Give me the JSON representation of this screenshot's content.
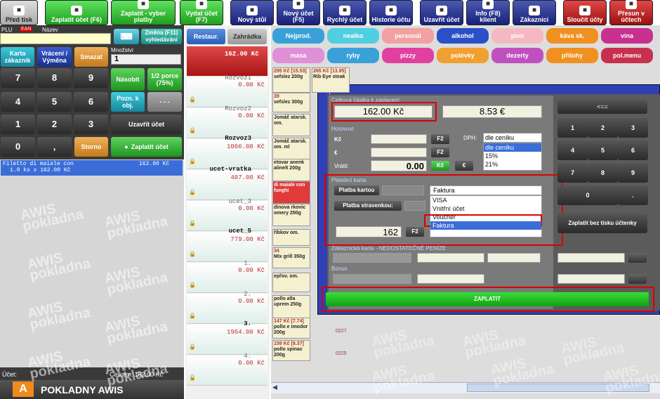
{
  "toolbar": {
    "buttons": [
      "Před tisk",
      "Zaplatit účet (F6)",
      "Zaplatit - vyber platby",
      "Vydat účet (F7)",
      "Nový stůl",
      "Nový účet (F5)",
      "Rychlý účet",
      "Historie účtu",
      "Uzavřít účet",
      "Info (F8) klient",
      "Zákazníci",
      "Sloučit účty",
      "Přesun v účtech"
    ]
  },
  "left": {
    "plu": "PLU",
    "ean": "EAN",
    "nazev": "Název",
    "zmena": "Změna (F11) vyhledávání",
    "karta": "Karta zákazník",
    "vraceni": "Vrácení / Výměna",
    "smazat": "Smazat",
    "mnozstvi_lbl": "Množství",
    "mnozstvi": "1",
    "nasobit": "Násobit",
    "pul": "1/2 porce (75%)",
    "pozn": "Pozn. k obj.",
    "dash": "- - -",
    "uzavrit": "Uzavřít účet",
    "storno": "Storno",
    "zaplatit": "Zaplatit účet",
    "keys": [
      "7",
      "8",
      "9",
      "4",
      "5",
      "6",
      "1",
      "2",
      "3",
      "0",
      ","
    ],
    "line1": "Filetto di maiale con",
    "line1_price": "162.00 Kč",
    "line2": "1.0 ks x 162.00 Kč",
    "ucet": "Účet:",
    "celkem": "Celkem: 162.00 Kč",
    "brand": "POKLADNY AWIS",
    "wm1": "AWIS",
    "wm2": "pokladna"
  },
  "mid": {
    "tab1": "Restaur.",
    "tab2": "Zahrádka",
    "top_price": "162.00 Kč",
    "rows": [
      {
        "name": "Rozvoz1",
        "price": "0.00 Kč"
      },
      {
        "name": "Rozvoz2",
        "price": "0.00 Kč"
      },
      {
        "name": "Rozvoz3",
        "price": "1066.00 Kč"
      },
      {
        "name": "ucet-vratka",
        "price": "407.00 Kč"
      },
      {
        "name": "ucet_3",
        "price": "0.00 Kč"
      },
      {
        "name": "ucet_5",
        "price": "779.00 Kč"
      },
      {
        "name": "1.",
        "price": "0.00 Kč"
      },
      {
        "name": "2.",
        "price": "0.00 Kč"
      },
      {
        "name": "3.",
        "price": "1964.00 Kč"
      },
      {
        "name": "4.",
        "price": "0.00 Kč"
      }
    ]
  },
  "categories": {
    "row1": [
      "Nejprod.",
      "nealko",
      "personál",
      "alkohol",
      "pivo",
      "káva sk.",
      "vína"
    ],
    "row2": [
      "masa",
      "ryby",
      "pizzy",
      "polévky",
      "dezerty",
      "přílohy",
      "pol.menu"
    ]
  },
  "tiles": [
    {
      "name": "sefslez 200g",
      "price": "295 Kč [15.53]"
    },
    {
      "name": "Rib Eye steak",
      "price": "265 Kč [13.95]"
    },
    {
      "name": "sefslez 300g",
      "price": "39"
    },
    {
      "name": "Jomáč atarsk. om.",
      "price": ""
    },
    {
      "name": "Jomáč atarsk. om. ml",
      "price": ""
    },
    {
      "name": "etovar anenk alinelt 200g",
      "price": ""
    },
    {
      "name": "di maiale con funghi",
      "price": ""
    },
    {
      "name": "dinova rkovic omery 250g",
      "price": ""
    },
    {
      "name": "říbkov om.",
      "price": ""
    },
    {
      "name": "Mix grill 350g",
      "price": "34"
    },
    {
      "name": "epřov. om.",
      "price": ""
    },
    {
      "name": "pollo alla uprem 250g",
      "price": ""
    },
    {
      "name": "pollo e imodor 200g",
      "price": "147 Kč [7.74]"
    },
    {
      "name": "pollo spinac 200g",
      "price": "159 Kč [8.37]"
    }
  ],
  "tile_codes": [
    "0227",
    "0225"
  ],
  "dialog": {
    "title": "Zaplatit",
    "celkova": "Celková částka k zaplacení",
    "kc": "162.00 Kč",
    "eur": "8.53 €",
    "hotovost": "Hotovost",
    "kc_lbl": "Kč",
    "eur_lbl": "€",
    "f2": "F2",
    "vratit": "Vrátit:",
    "vratit_val": "0.00",
    "kc_btn": "Kč",
    "eur_btn": "€",
    "dph": "DPH:",
    "dph_sel": "dle ceníku",
    "dph_opts": [
      "dle ceníku",
      "15%",
      "21%"
    ],
    "platebni": "Platební karta",
    "platba_kartou": "Platba kartou",
    "platba_strav": "Platba stravenkou:",
    "card_sel": "Faktura",
    "card_opts": [
      "VISA",
      "Vnitřní účet",
      "Voucher",
      "Faktura"
    ],
    "card_amount": "162",
    "zakaznicka": "Zákaznická karta - NEDOSTATEČNÉ PENÍZE",
    "bonus": "Bonus",
    "zaplatit": "ZAPLATIT",
    "back": "<==",
    "numkeys": [
      "1",
      "2",
      "3",
      "4",
      "5",
      "6",
      "7",
      "8",
      "9",
      "0",
      "."
    ],
    "bez_tisku": "Zaplatit bez tisku účtenky"
  },
  "colors": {
    "green": "#22a022",
    "navy": "#1c247e",
    "red": "#b21818",
    "pink": "#d64aa8"
  }
}
